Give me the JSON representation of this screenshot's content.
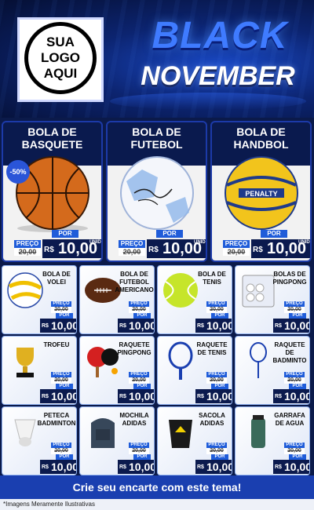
{
  "header": {
    "logo_lines": [
      "SUA",
      "LOGO",
      "AQUI"
    ],
    "title_line1": "BLACK",
    "title_line2": "NOVEMBER"
  },
  "price_labels": {
    "old_label": "PREÇO",
    "new_label": "POR",
    "unit": "UNID",
    "old_price": "20,00",
    "currency": "R$",
    "new_price": "10,00"
  },
  "featured": [
    {
      "name_line1": "BOLA DE",
      "name_line2": "BASQUETE",
      "badge": "-50%"
    },
    {
      "name_line1": "BOLA DE",
      "name_line2": "FUTEBOL"
    },
    {
      "name_line1": "BOLA DE",
      "name_line2": "HANDBOL"
    }
  ],
  "products": [
    {
      "name": "BOLA DE VOLEI"
    },
    {
      "name": "BOLA DE FUTEBOL AMERICANO"
    },
    {
      "name": "BOLA DE TENIS"
    },
    {
      "name": "BOLAS DE PINGPONG"
    },
    {
      "name": "TROFEU"
    },
    {
      "name": "RAQUETE PINGPONG"
    },
    {
      "name": "RAQUETE DE TENIS"
    },
    {
      "name": "RAQUETE DE BADMINTO"
    },
    {
      "name": "PETECA BADMINTON"
    },
    {
      "name": "MOCHILA ADIDAS"
    },
    {
      "name": "SACOLA ADIDAS"
    },
    {
      "name": "GARRAFA DE AGUA"
    }
  ],
  "footer": {
    "cta": "Crie seu encarte com este tema!",
    "disclaimer": "*Imagens Meramente Ilustrativas"
  },
  "colors": {
    "accent": "#1f5cd9",
    "dark": "#0b1a4e",
    "brand_blue": "#3f7bff"
  }
}
